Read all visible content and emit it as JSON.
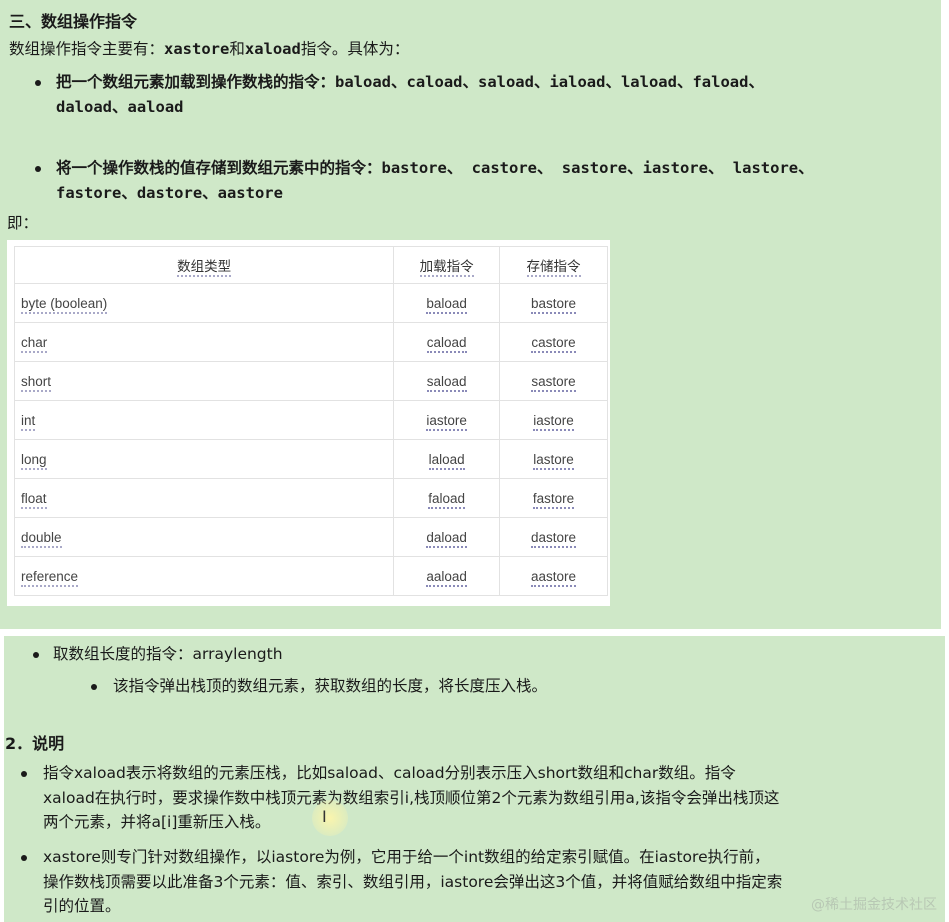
{
  "section3": {
    "title": "三、数组操作指令",
    "intro_a": "数组操作指令主要有：",
    "intro_b": "xastore",
    "intro_c": "和",
    "intro_d": "xaload",
    "intro_e": "指令。具体为：",
    "load_line1": "把一个数组元素加载到操作数栈的指令：baload、caload、saload、iaload、laload、faload、",
    "load_line2": "daload、aaload",
    "store_line1": "将一个操作数栈的值存储到数组元素中的指令：bastore、 castore、 sastore、iastore、 lastore、",
    "store_line2": "fastore、dastore、aastore",
    "ji": "即："
  },
  "table": {
    "headers": [
      "数组类型",
      "加载指令",
      "存储指令"
    ],
    "rows": [
      [
        "byte (boolean)",
        "baload",
        "bastore"
      ],
      [
        "char",
        "caload",
        "castore"
      ],
      [
        "short",
        "saload",
        "sastore"
      ],
      [
        "int",
        "iastore",
        "iastore"
      ],
      [
        "long",
        "laload",
        "lastore"
      ],
      [
        "float",
        "faload",
        "fastore"
      ],
      [
        "double",
        "daload",
        "dastore"
      ],
      [
        "reference",
        "aaload",
        "aastore"
      ]
    ]
  },
  "arraylength": {
    "line": "取数组长度的指令：arraylength",
    "sub": "该指令弹出栈顶的数组元素，获取数组的长度，将长度压入栈。"
  },
  "section2": {
    "title": "2．说明",
    "p1_l1": "指令xaload表示将数组的元素压栈，比如saload、caload分别表示压入short数组和char数组。指令",
    "p1_l2": "xaload在执行时，要求操作数中栈顶元素为数组索引i,栈顶顺位第2个元素为数组引用a,该指令会弹出栈顶这",
    "p1_l3": "两个元素，并将a[i]重新压入栈。",
    "p2_l1": "xastore则专门针对数组操作，以iastore为例，它用于给一个int数组的给定索引赋值。在iastore执行前，",
    "p2_l2": "操作数栈顶需要以此准备3个元素：值、索引、数组引用，iastore会弹出这3个值，并将值赋给数组中指定索",
    "p2_l3": "引的位置。"
  },
  "watermark": "@稀土掘金技术社区",
  "cursor_icon": "text-cursor-icon"
}
